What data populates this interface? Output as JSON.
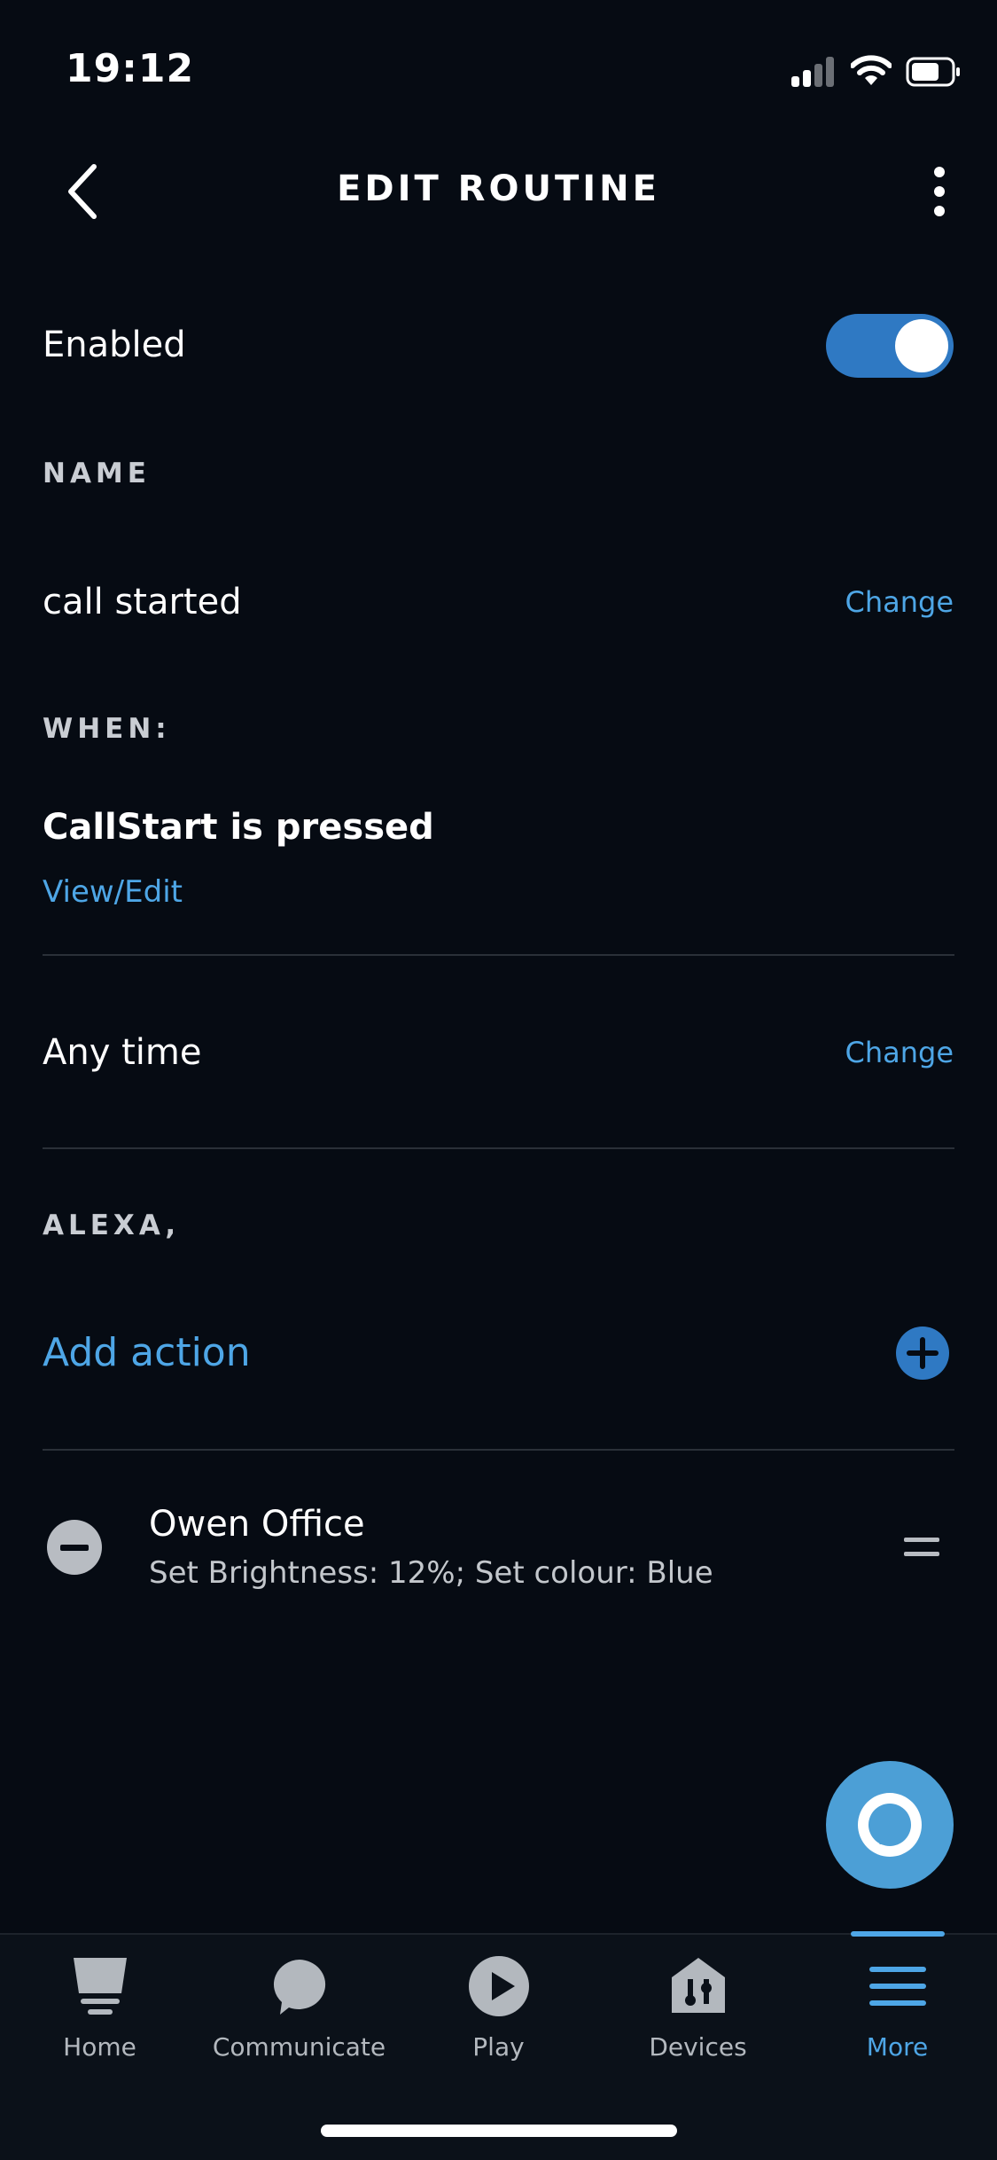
{
  "status_bar": {
    "time": "19:12"
  },
  "header": {
    "title": "EDIT ROUTINE"
  },
  "enabled": {
    "label": "Enabled",
    "on": true
  },
  "name_section": {
    "label": "NAME",
    "value": "call started",
    "change_label": "Change"
  },
  "when_section": {
    "label": "WHEN:",
    "trigger": "CallStart is pressed",
    "view_edit_label": "View/Edit"
  },
  "time_section": {
    "value": "Any time",
    "change_label": "Change"
  },
  "alexa_section": {
    "label": "ALEXA,",
    "add_action_label": "Add action"
  },
  "actions": [
    {
      "title": "Owen Office",
      "detail": "Set Brightness: 12%; Set colour: Blue"
    }
  ],
  "tabs": [
    {
      "label": "Home",
      "icon": "home-icon"
    },
    {
      "label": "Communicate",
      "icon": "chat-bubble-icon"
    },
    {
      "label": "Play",
      "icon": "play-icon"
    },
    {
      "label": "Devices",
      "icon": "devices-icon"
    },
    {
      "label": "More",
      "icon": "menu-icon",
      "active": true
    }
  ],
  "colors": {
    "accent": "#4ea6e6",
    "toggle": "#2f79c3",
    "background": "#060b13"
  }
}
